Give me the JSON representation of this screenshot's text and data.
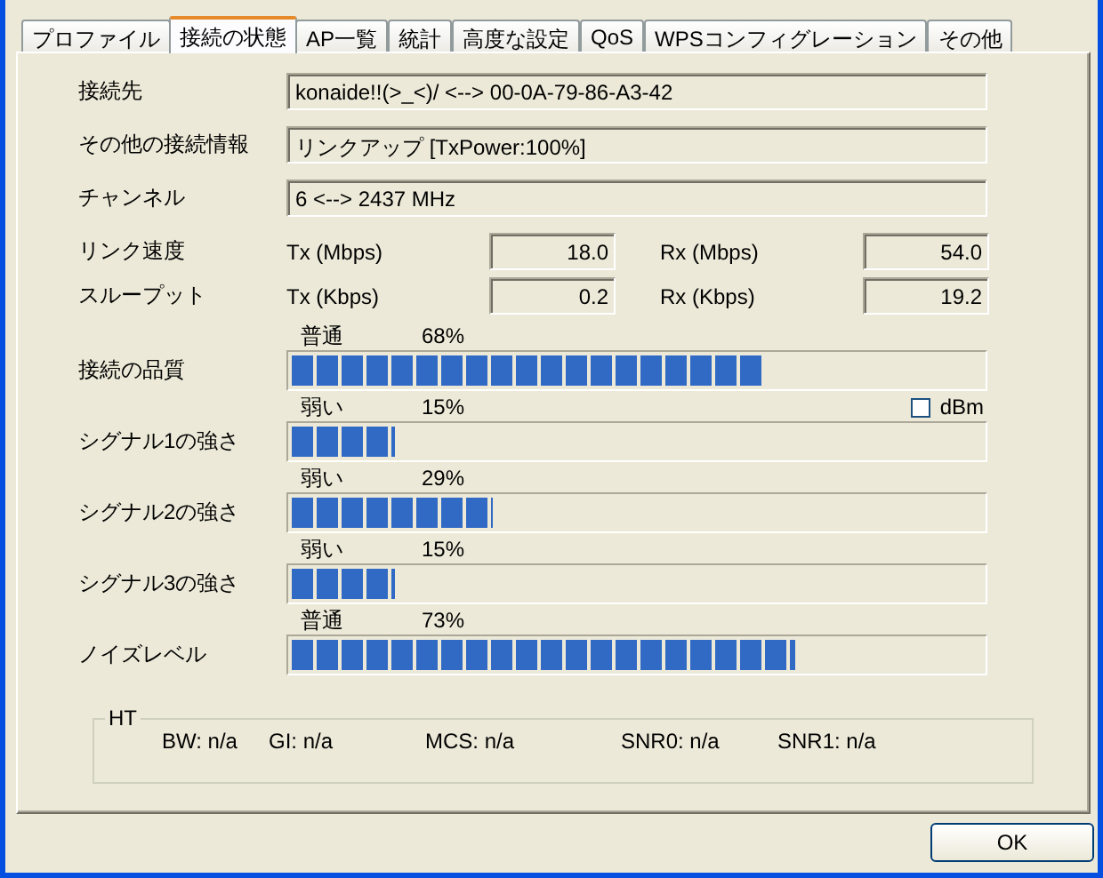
{
  "tabs": [
    {
      "label": "プロファイル",
      "selected": false
    },
    {
      "label": "接続の状態",
      "selected": true
    },
    {
      "label": "AP一覧",
      "selected": false
    },
    {
      "label": "統計",
      "selected": false
    },
    {
      "label": "高度な設定",
      "selected": false
    },
    {
      "label": "QoS",
      "selected": false
    },
    {
      "label": "WPSコンフィグレーション",
      "selected": false
    },
    {
      "label": "その他",
      "selected": false
    }
  ],
  "info": [
    {
      "label": "接続先",
      "value": "konaide!!(>_<)/ <--> 00-0A-79-86-A3-42"
    },
    {
      "label": "その他の接続情報",
      "value": "リンクアップ [TxPower:100%]"
    },
    {
      "label": "チャンネル",
      "value": "6 <--> 2437 MHz"
    }
  ],
  "rates": [
    {
      "label": "リンク速度",
      "tx_label": "Tx (Mbps)",
      "tx": "18.0",
      "rx_label": "Rx (Mbps)",
      "rx": "54.0"
    },
    {
      "label": "スループット",
      "tx_label": "Tx (Kbps)",
      "tx": "0.2",
      "rx_label": "Rx (Kbps)",
      "rx": "19.2"
    }
  ],
  "meters": [
    {
      "label": "接続の品質",
      "rating": "普通",
      "percent": "68%",
      "level": 0.68
    },
    {
      "label": "シグナル1の強さ",
      "rating": "弱い",
      "percent": "15%",
      "level": 0.15
    },
    {
      "label": "シグナル2の強さ",
      "rating": "弱い",
      "percent": "29%",
      "level": 0.29
    },
    {
      "label": "シグナル3の強さ",
      "rating": "弱い",
      "percent": "15%",
      "level": 0.15
    },
    {
      "label": "ノイズレベル",
      "rating": "普通",
      "percent": "73%",
      "level": 0.73
    }
  ],
  "dbm": {
    "label": "dBm",
    "checked": false
  },
  "ht": {
    "title": "HT",
    "items": [
      "BW: n/a",
      "GI: n/a",
      "MCS: n/a",
      "SNR0: n/a",
      "SNR1: n/a"
    ]
  },
  "buttons": [
    "OK"
  ]
}
